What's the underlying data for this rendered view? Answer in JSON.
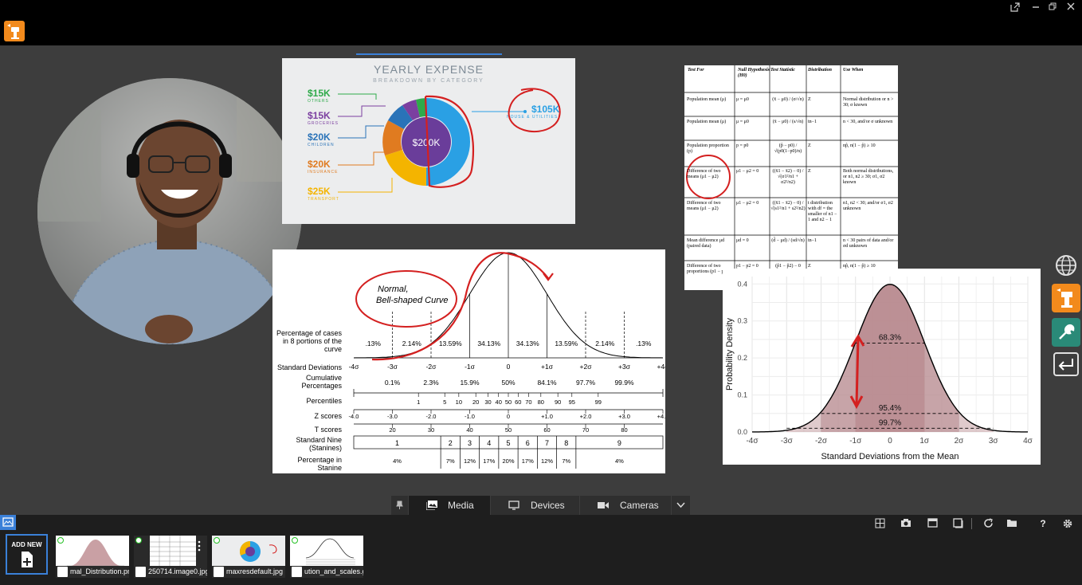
{
  "app": {
    "name": "presentation-board"
  },
  "expense": {
    "title": "YEARLY EXPENSE",
    "subtitle": "BREAKDOWN BY CATEGORY",
    "center": "$200K",
    "items": [
      {
        "amount": "$15K",
        "category": "OTHERS",
        "color": "#2eaa4a"
      },
      {
        "amount": "$15K",
        "category": "GROCERIES",
        "color": "#7b3fa0"
      },
      {
        "amount": "$20K",
        "category": "CHILDREN",
        "color": "#2a73b8"
      },
      {
        "amount": "$20K",
        "category": "INSURANCE",
        "color": "#e07b20"
      },
      {
        "amount": "$25K",
        "category": "TRANSPORT",
        "color": "#f4b400"
      }
    ],
    "right": {
      "amount": "$105K",
      "category": "HOUSE & UTILITIES",
      "color": "#2aa0e4"
    }
  },
  "stats_table": {
    "headers": [
      "Test For",
      "Null Hypothesis (H0)",
      "Test Statistic",
      "Distribution",
      "Use When"
    ],
    "rows": [
      {
        "test": "Population mean (μ)",
        "null": "μ = μ0",
        "stat": "(x̄ − μ0) / (σ/√n)",
        "dist": "Z",
        "use": "Normal distribution or n > 30; σ known"
      },
      {
        "test": "Population mean (μ)",
        "null": "μ = μ0",
        "stat": "(x̄ − μ0) / (s/√n)",
        "dist": "tn−1",
        "use": "n < 30, and/or σ unknown"
      },
      {
        "test": "Population proportion (p)",
        "null": "p = p0",
        "stat": "(p̂ − p0) / √(p0(1−p0)/n)",
        "dist": "Z",
        "use": "np̂, n(1 − p̂) ≥ 10"
      },
      {
        "test": "Difference of two means (μ1 − μ2)",
        "null": "μ1 − μ2 = 0",
        "stat": "((x̄1 − x̄2) − 0) / √(σ1²/n1 + σ2²/n2)",
        "dist": "Z",
        "use": "Both normal distributions, or n1, n2 ≥ 30; σ1, σ2 known"
      },
      {
        "test": "Difference of two means (μ1 − μ2)",
        "null": "μ1 − μ2 = 0",
        "stat": "((x̄1 − x̄2) − 0) / √(s1²/n1 + s2²/n2)",
        "dist": "t distribution with df = the smaller of n1 − 1 and n2 − 1",
        "use": "n1, n2 < 30; and/or σ1, σ2 unknown"
      },
      {
        "test": "Mean difference μd (paired data)",
        "null": "μd = 0",
        "stat": "(d̄ − μd) / (sd/√n)",
        "dist": "tn−1",
        "use": "n < 30 pairs of data and/or σd unknown"
      },
      {
        "test": "Difference of two proportions (p1 − p2)",
        "null": "p1 − p2 = 0",
        "stat": "(p̂1 − p̂2) − 0",
        "dist": "Z",
        "use": "np̂, n(1 − p̂) ≥ 10"
      }
    ]
  },
  "bell": {
    "annotation": [
      "Normal,",
      "Bell-shaped Curve"
    ],
    "row_labels": [
      "Percentage of cases in 8 portions of the curve",
      "Standard Deviations",
      "Cumulative Percentages",
      "Percentiles",
      "Z scores",
      "T scores",
      "Standard Nine (Stanines)",
      "Percentage in Stanine"
    ],
    "portions": [
      ".13%",
      "2.14%",
      "13.59%",
      "34.13%",
      "34.13%",
      "13.59%",
      "2.14%",
      ".13%"
    ],
    "sd": [
      "-4σ",
      "-3σ",
      "-2σ",
      "-1σ",
      "0",
      "+1σ",
      "+2σ",
      "+3σ",
      "+4σ"
    ],
    "cumulative": [
      "0.1%",
      "2.3%",
      "15.9%",
      "50%",
      "84.1%",
      "97.7%",
      "99.9%"
    ],
    "percentiles": [
      "1",
      "5",
      "10",
      "20",
      "30",
      "40",
      "50",
      "60",
      "70",
      "80",
      "90",
      "95",
      "99"
    ],
    "z": [
      "-4.0",
      "-3.0",
      "-2.0",
      "-1.0",
      "0",
      "+1.0",
      "+2.0",
      "+3.0",
      "+4.0"
    ],
    "t": [
      "20",
      "30",
      "40",
      "50",
      "60",
      "70",
      "80"
    ],
    "stanines": [
      "1",
      "2",
      "3",
      "4",
      "5",
      "6",
      "7",
      "8",
      "9"
    ],
    "stanine_pct": [
      "4%",
      "7%",
      "12%",
      "17%",
      "20%",
      "17%",
      "12%",
      "7%",
      "4%"
    ]
  },
  "chart_data": {
    "type": "area",
    "title": "",
    "xlabel": "Standard Deviations from the Mean",
    "ylabel": "Probability Density",
    "x_ticks": [
      "-4σ",
      "-3σ",
      "-2σ",
      "-1σ",
      "0",
      "1σ",
      "2σ",
      "3σ",
      "4σ"
    ],
    "y_ticks": [
      "0.0",
      "0.1",
      "0.2",
      "0.3",
      "0.4"
    ],
    "xlim": [
      -4,
      4
    ],
    "ylim": [
      0,
      0.42
    ],
    "bands": [
      {
        "label": "68.3%",
        "from": -1,
        "to": 1
      },
      {
        "label": "95.4%",
        "from": -2,
        "to": 2
      },
      {
        "label": "99.7%",
        "from": -3,
        "to": 3
      }
    ],
    "grid": true,
    "colors": {
      "fill": "#b88a8f",
      "curve": "#000000"
    }
  },
  "tabs": [
    {
      "label": "Media",
      "active": true
    },
    {
      "label": "Devices",
      "active": false
    },
    {
      "label": "Cameras",
      "active": false
    }
  ],
  "tray": {
    "add_new": "ADD NEW",
    "files": [
      {
        "name": "mal_Distribution.png"
      },
      {
        "name": "250714.image0.jpg"
      },
      {
        "name": "maxresdefault.jpg"
      },
      {
        "name": "ution_and_scales.gif"
      }
    ]
  },
  "colors": {
    "accent": "#f28a1c",
    "highlight": "#3a80d8",
    "annotation": "#d42020"
  }
}
